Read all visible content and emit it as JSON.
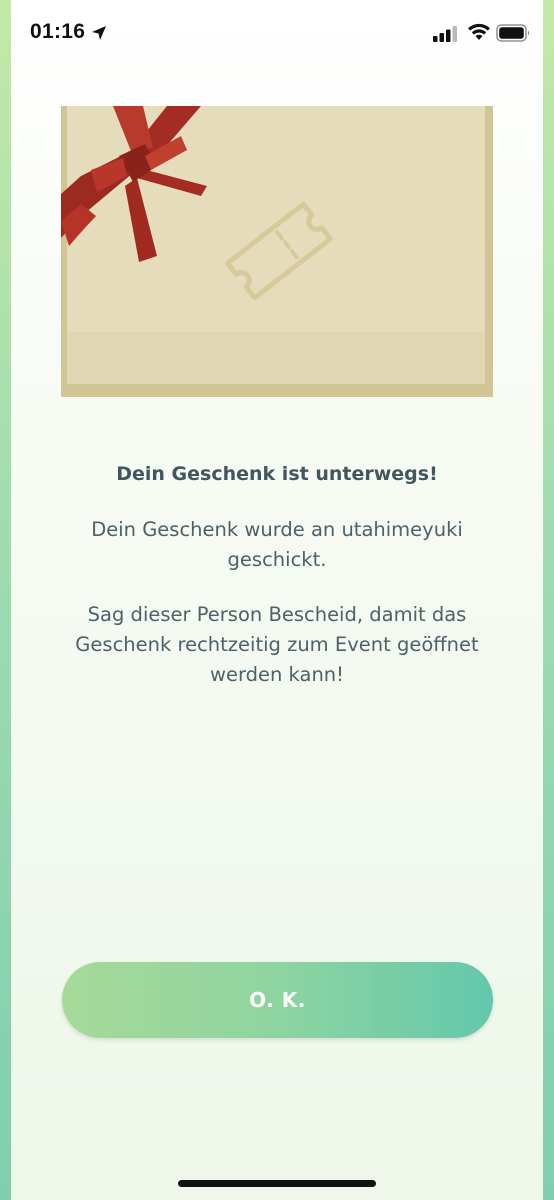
{
  "status_bar": {
    "time": "01:16",
    "icons": [
      "location-arrow-icon",
      "cellular-signal-icon",
      "wifi-icon",
      "battery-icon"
    ]
  },
  "gift": {
    "illustration": "gift-box-with-red-ribbon",
    "ticket_icon": "ticket-icon",
    "colors": {
      "box": "#e5dcbc",
      "border": "#d2c595",
      "ribbon": "#a52c22",
      "ticket_outline": "#d7c99a"
    }
  },
  "dialog": {
    "title": "Dein Geschenk ist unterwegs!",
    "message_line1": "Dein Geschenk wurde an utahimeyuki geschickt.",
    "message_line2": "Sag dieser Person Bescheid, damit das Geschenk rechtzeitig zum Event geöffnet werden kann!"
  },
  "actions": {
    "ok_label": "O. K."
  },
  "colors": {
    "accent_start": "#a6da99",
    "accent_end": "#63c8ad",
    "text": "#4d6169"
  }
}
